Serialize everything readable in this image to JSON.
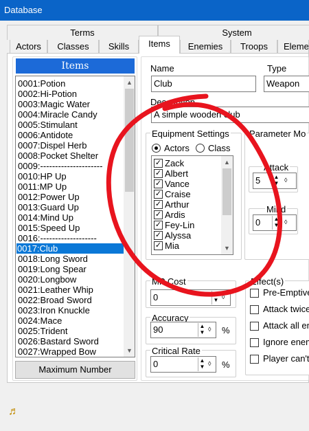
{
  "window": {
    "title": "Database"
  },
  "tabs": {
    "top_row": [
      {
        "label": "Terms"
      },
      {
        "label": "System"
      }
    ],
    "middle_row": [
      {
        "label": "Actors"
      },
      {
        "label": "Classes"
      },
      {
        "label": "Skills"
      },
      {
        "label": "Items"
      },
      {
        "label": "Enemies"
      },
      {
        "label": "Troops"
      },
      {
        "label": "Eleme"
      }
    ],
    "active": "Items"
  },
  "items_list": {
    "header": "Items",
    "items": [
      "0001:Potion",
      "0002:Hi-Potion",
      "0003:Magic Water",
      "0004:Miracle Candy",
      "0005:Stimulant",
      "0006:Antidote",
      "0007:Dispel Herb",
      "0008:Pocket Shelter",
      "0009:---------------------",
      "0010:HP Up",
      "0011:MP Up",
      "0012:Power Up",
      "0013:Guard Up",
      "0014:Mind Up",
      "0015:Speed Up",
      "0016:-------------------",
      "0017:Club",
      "0018:Long Sword",
      "0019:Long Spear",
      "0020:Longbow",
      "0021:Leather Whip",
      "0022:Broad Sword",
      "0023:Iron Knuckle",
      "0024:Mace",
      "0025:Trident",
      "0026:Bastard Sword",
      "0027:Wrapped Bow"
    ],
    "selected_index": 16,
    "max_button": "Maximum Number"
  },
  "form": {
    "name_label": "Name",
    "name_value": "Club",
    "type_label": "Type",
    "type_value": "Weapon",
    "description_label": "Description",
    "description_value": "A simple wooden club",
    "equipment": {
      "title": "Equipment Settings",
      "radio_actors": "Actors",
      "radio_class": "Class",
      "selected": "Actors",
      "actors": [
        "Zack",
        "Albert",
        "Vance",
        "Craise",
        "Arthur",
        "Ardis",
        "Fey-Lin",
        "Alyssa",
        "Mia"
      ]
    },
    "param_mod": {
      "title": "Parameter Mo",
      "attack_label": "Attack",
      "attack_value": "5",
      "mind_label": "Mind",
      "mind_value": "0"
    },
    "mp_cost": {
      "label": "MP Cost",
      "value": "0"
    },
    "accuracy": {
      "label": "Accuracy",
      "value": "90",
      "unit": "%"
    },
    "critical": {
      "label": "Critical Rate",
      "value": "0",
      "unit": "%"
    },
    "effects": {
      "title": "Effect(s)",
      "items": [
        "Pre-Emptive",
        "Attack twice",
        "Attack all en",
        "Ignore enem",
        "Player can't"
      ]
    }
  },
  "annotation": {
    "color": "#e8141e"
  },
  "status": {
    "icon": "music-note-icon"
  }
}
